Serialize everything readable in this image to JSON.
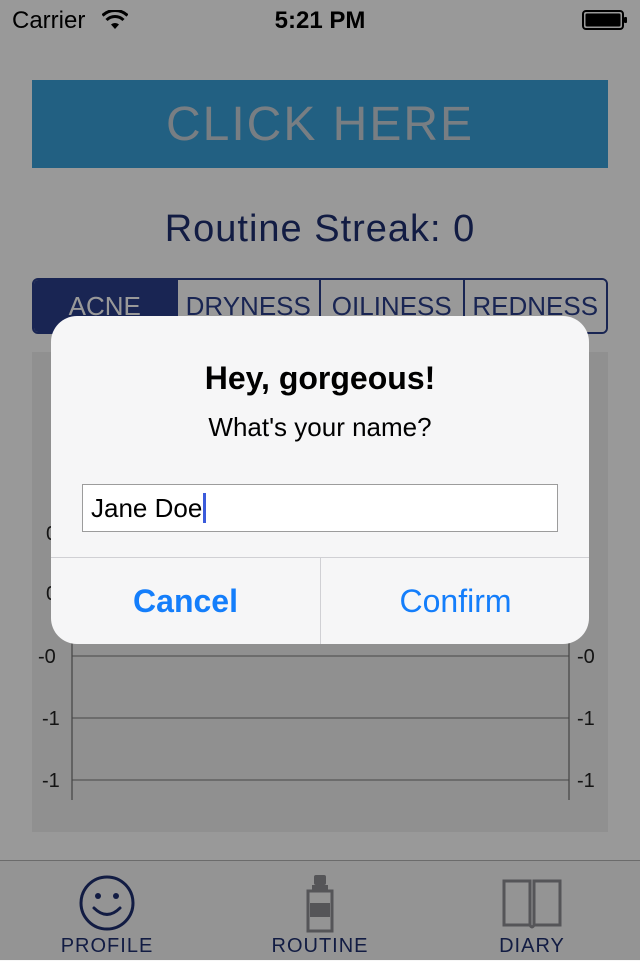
{
  "status_bar": {
    "carrier": "Carrier",
    "time": "5:21 PM"
  },
  "banner": {
    "label": "CLICK HERE"
  },
  "streak": {
    "text": "Routine Streak: 0"
  },
  "segments": {
    "items": [
      {
        "label": "ACNE",
        "selected": true
      },
      {
        "label": "DRYNESS",
        "selected": false
      },
      {
        "label": "OILINESS",
        "selected": false
      },
      {
        "label": "REDNESS",
        "selected": false
      }
    ]
  },
  "chart": {
    "y_labels": [
      "0",
      "0",
      "-0",
      "-1",
      "-1"
    ],
    "accent_color": "#2b3f8a"
  },
  "tabbar": {
    "items": [
      {
        "label": "PROFILE",
        "icon": "smiley-icon",
        "selected": true
      },
      {
        "label": "ROUTINE",
        "icon": "bottle-icon",
        "selected": false
      },
      {
        "label": "DIARY",
        "icon": "book-icon",
        "selected": false
      }
    ]
  },
  "alert": {
    "title": "Hey, gorgeous!",
    "message": "What's your name?",
    "input_value": "Jane Doe",
    "cancel_label": "Cancel",
    "confirm_label": "Confirm"
  },
  "colors": {
    "banner_bg": "#39a0d9",
    "navy": "#1e2f70",
    "ios_blue": "#147efb"
  }
}
